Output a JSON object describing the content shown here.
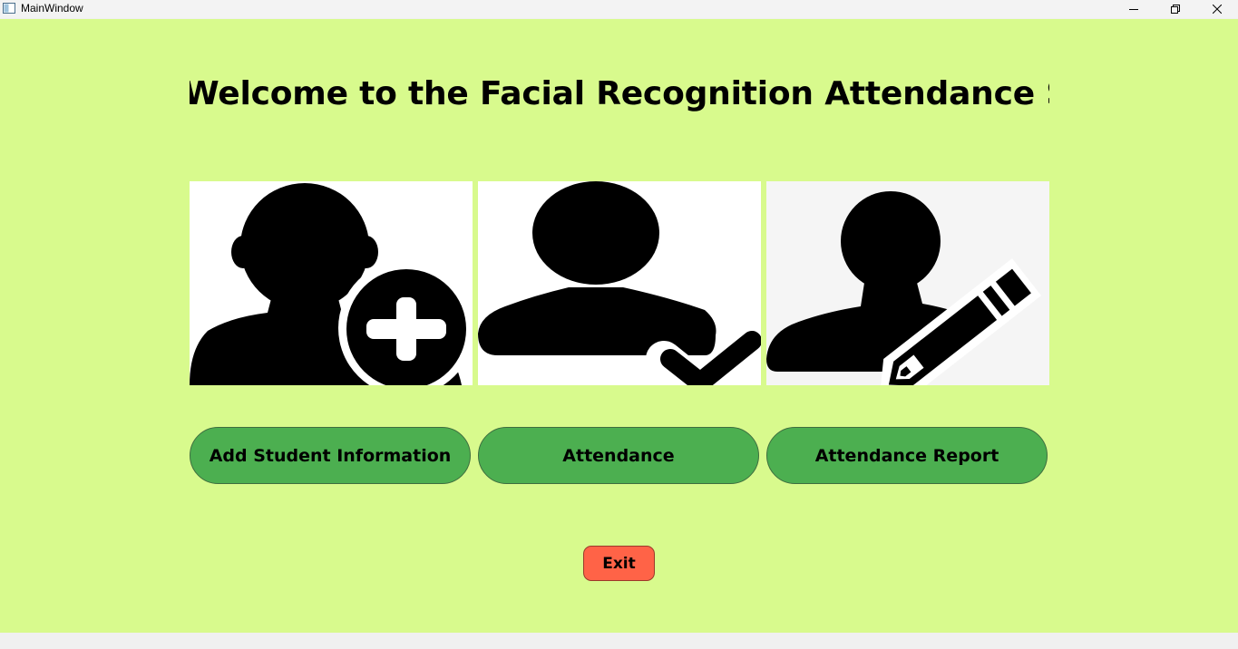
{
  "window": {
    "title": "MainWindow",
    "controls": [
      "minimize-icon",
      "restore-icon",
      "close-icon"
    ]
  },
  "main": {
    "headline": "Welcome to the Facial Recognition Attendance System!",
    "cards": [
      {
        "icon": "add-user-icon",
        "button_label": "Add Student Information"
      },
      {
        "icon": "user-check-icon",
        "button_label": "Attendance"
      },
      {
        "icon": "user-edit-icon",
        "button_label": "Attendance Report"
      }
    ],
    "exit_label": "Exit"
  },
  "colors": {
    "background": "#d8fa8d",
    "button_green": "#4caf50",
    "exit_red": "#ff6347"
  }
}
